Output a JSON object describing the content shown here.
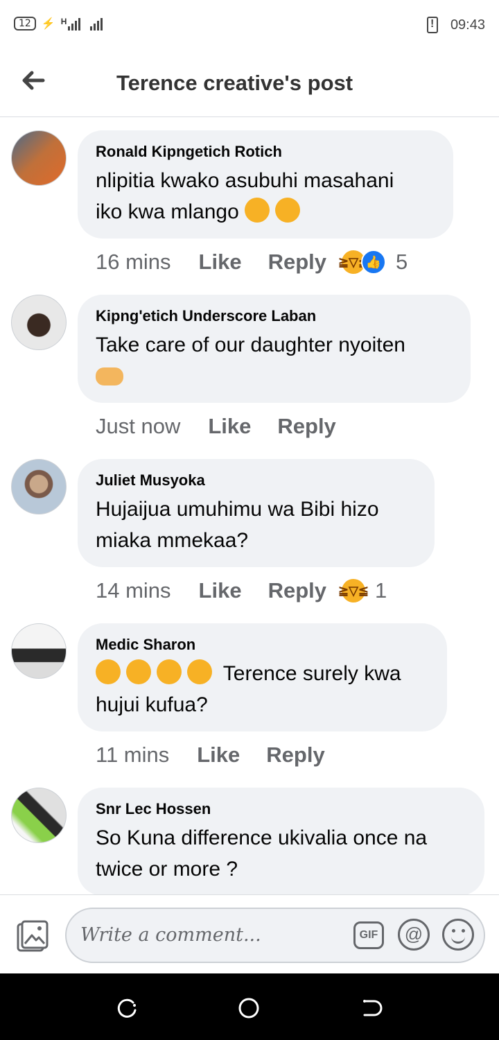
{
  "status_bar": {
    "battery_level": "12",
    "signal_label": "H",
    "time": "09:43"
  },
  "header": {
    "title": "Terence creative's post"
  },
  "comments": [
    {
      "author": "Ronald Kipngetich Rotich",
      "text_line1": "nlipitia kwako asubuhi masahani",
      "text_line2": "iko kwa mlango",
      "time": "16 mins",
      "like_label": "Like",
      "reply_label": "Reply",
      "reaction_count": "5",
      "reactions": [
        "laughing-emoji",
        "thumbs-up"
      ]
    },
    {
      "author": "Kipng'etich Underscore Laban",
      "text_line1": "Take care of our daughter nyoiten",
      "time": "Just now",
      "like_label": "Like",
      "reply_label": "Reply"
    },
    {
      "author": "Juliet Musyoka",
      "text_line1": "Hujaijua umuhimu wa Bibi hizo",
      "text_line2": "miaka mmekaa?",
      "time": "14 mins",
      "like_label": "Like",
      "reply_label": "Reply",
      "reaction_count": "1",
      "reactions": [
        "laughing-emoji"
      ]
    },
    {
      "author": "Medic Sharon",
      "text_line1": "Terence surely kwa",
      "text_line2": "hujui kufua?",
      "time": "11 mins",
      "like_label": "Like",
      "reply_label": "Reply"
    },
    {
      "author": "Snr Lec Hossen",
      "text_line1": "So Kuna difference ukivalia once na",
      "text_line2": "twice or more ?"
    }
  ],
  "composer": {
    "placeholder": "Write a comment...",
    "gif_label": "GIF",
    "at_label": "@"
  },
  "colors": {
    "bubble": "#f0f2f5",
    "meta_text": "#65676b",
    "like_blue": "#1877f2",
    "emoji_yellow": "#f7b125"
  }
}
